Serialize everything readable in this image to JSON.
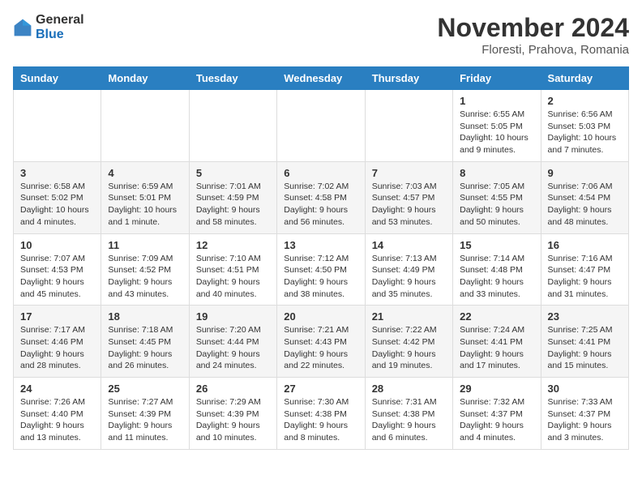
{
  "logo": {
    "general": "General",
    "blue": "Blue"
  },
  "header": {
    "month": "November 2024",
    "location": "Floresti, Prahova, Romania"
  },
  "weekdays": [
    "Sunday",
    "Monday",
    "Tuesday",
    "Wednesday",
    "Thursday",
    "Friday",
    "Saturday"
  ],
  "weeks": [
    [
      {
        "day": "",
        "detail": ""
      },
      {
        "day": "",
        "detail": ""
      },
      {
        "day": "",
        "detail": ""
      },
      {
        "day": "",
        "detail": ""
      },
      {
        "day": "",
        "detail": ""
      },
      {
        "day": "1",
        "detail": "Sunrise: 6:55 AM\nSunset: 5:05 PM\nDaylight: 10 hours and 9 minutes."
      },
      {
        "day": "2",
        "detail": "Sunrise: 6:56 AM\nSunset: 5:03 PM\nDaylight: 10 hours and 7 minutes."
      }
    ],
    [
      {
        "day": "3",
        "detail": "Sunrise: 6:58 AM\nSunset: 5:02 PM\nDaylight: 10 hours and 4 minutes."
      },
      {
        "day": "4",
        "detail": "Sunrise: 6:59 AM\nSunset: 5:01 PM\nDaylight: 10 hours and 1 minute."
      },
      {
        "day": "5",
        "detail": "Sunrise: 7:01 AM\nSunset: 4:59 PM\nDaylight: 9 hours and 58 minutes."
      },
      {
        "day": "6",
        "detail": "Sunrise: 7:02 AM\nSunset: 4:58 PM\nDaylight: 9 hours and 56 minutes."
      },
      {
        "day": "7",
        "detail": "Sunrise: 7:03 AM\nSunset: 4:57 PM\nDaylight: 9 hours and 53 minutes."
      },
      {
        "day": "8",
        "detail": "Sunrise: 7:05 AM\nSunset: 4:55 PM\nDaylight: 9 hours and 50 minutes."
      },
      {
        "day": "9",
        "detail": "Sunrise: 7:06 AM\nSunset: 4:54 PM\nDaylight: 9 hours and 48 minutes."
      }
    ],
    [
      {
        "day": "10",
        "detail": "Sunrise: 7:07 AM\nSunset: 4:53 PM\nDaylight: 9 hours and 45 minutes."
      },
      {
        "day": "11",
        "detail": "Sunrise: 7:09 AM\nSunset: 4:52 PM\nDaylight: 9 hours and 43 minutes."
      },
      {
        "day": "12",
        "detail": "Sunrise: 7:10 AM\nSunset: 4:51 PM\nDaylight: 9 hours and 40 minutes."
      },
      {
        "day": "13",
        "detail": "Sunrise: 7:12 AM\nSunset: 4:50 PM\nDaylight: 9 hours and 38 minutes."
      },
      {
        "day": "14",
        "detail": "Sunrise: 7:13 AM\nSunset: 4:49 PM\nDaylight: 9 hours and 35 minutes."
      },
      {
        "day": "15",
        "detail": "Sunrise: 7:14 AM\nSunset: 4:48 PM\nDaylight: 9 hours and 33 minutes."
      },
      {
        "day": "16",
        "detail": "Sunrise: 7:16 AM\nSunset: 4:47 PM\nDaylight: 9 hours and 31 minutes."
      }
    ],
    [
      {
        "day": "17",
        "detail": "Sunrise: 7:17 AM\nSunset: 4:46 PM\nDaylight: 9 hours and 28 minutes."
      },
      {
        "day": "18",
        "detail": "Sunrise: 7:18 AM\nSunset: 4:45 PM\nDaylight: 9 hours and 26 minutes."
      },
      {
        "day": "19",
        "detail": "Sunrise: 7:20 AM\nSunset: 4:44 PM\nDaylight: 9 hours and 24 minutes."
      },
      {
        "day": "20",
        "detail": "Sunrise: 7:21 AM\nSunset: 4:43 PM\nDaylight: 9 hours and 22 minutes."
      },
      {
        "day": "21",
        "detail": "Sunrise: 7:22 AM\nSunset: 4:42 PM\nDaylight: 9 hours and 19 minutes."
      },
      {
        "day": "22",
        "detail": "Sunrise: 7:24 AM\nSunset: 4:41 PM\nDaylight: 9 hours and 17 minutes."
      },
      {
        "day": "23",
        "detail": "Sunrise: 7:25 AM\nSunset: 4:41 PM\nDaylight: 9 hours and 15 minutes."
      }
    ],
    [
      {
        "day": "24",
        "detail": "Sunrise: 7:26 AM\nSunset: 4:40 PM\nDaylight: 9 hours and 13 minutes."
      },
      {
        "day": "25",
        "detail": "Sunrise: 7:27 AM\nSunset: 4:39 PM\nDaylight: 9 hours and 11 minutes."
      },
      {
        "day": "26",
        "detail": "Sunrise: 7:29 AM\nSunset: 4:39 PM\nDaylight: 9 hours and 10 minutes."
      },
      {
        "day": "27",
        "detail": "Sunrise: 7:30 AM\nSunset: 4:38 PM\nDaylight: 9 hours and 8 minutes."
      },
      {
        "day": "28",
        "detail": "Sunrise: 7:31 AM\nSunset: 4:38 PM\nDaylight: 9 hours and 6 minutes."
      },
      {
        "day": "29",
        "detail": "Sunrise: 7:32 AM\nSunset: 4:37 PM\nDaylight: 9 hours and 4 minutes."
      },
      {
        "day": "30",
        "detail": "Sunrise: 7:33 AM\nSunset: 4:37 PM\nDaylight: 9 hours and 3 minutes."
      }
    ]
  ]
}
